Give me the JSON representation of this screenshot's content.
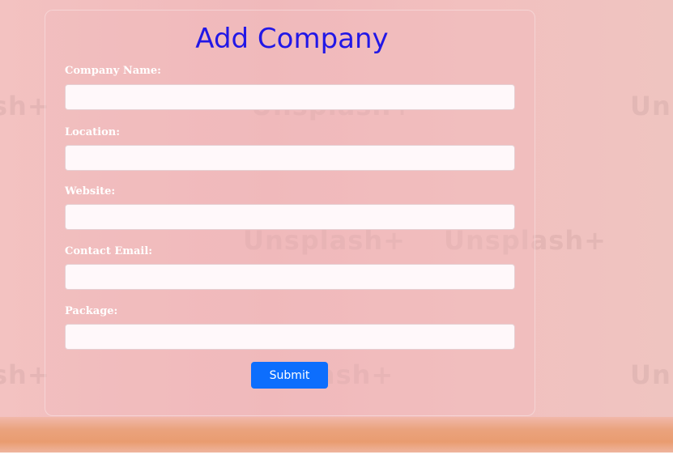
{
  "form": {
    "title": "Add Company",
    "fields": [
      {
        "label": "Company Name:",
        "value": "",
        "placeholder": ""
      },
      {
        "label": "Location:",
        "value": "",
        "placeholder": ""
      },
      {
        "label": "Website:",
        "value": "",
        "placeholder": ""
      },
      {
        "label": "Contact Email:",
        "value": "",
        "placeholder": ""
      },
      {
        "label": "Package:",
        "value": "",
        "placeholder": ""
      }
    ],
    "submit_label": "Submit"
  },
  "background": {
    "watermark_text": [
      "sh+",
      "Unsplash+",
      "Un",
      "Unsplash+",
      "Unsplash+",
      "sh+",
      "lash+",
      "Un"
    ]
  },
  "colors": {
    "title": "#2217e6",
    "button": "#0d6efd",
    "label": "#ffffff",
    "background": "#f1bcbd"
  }
}
